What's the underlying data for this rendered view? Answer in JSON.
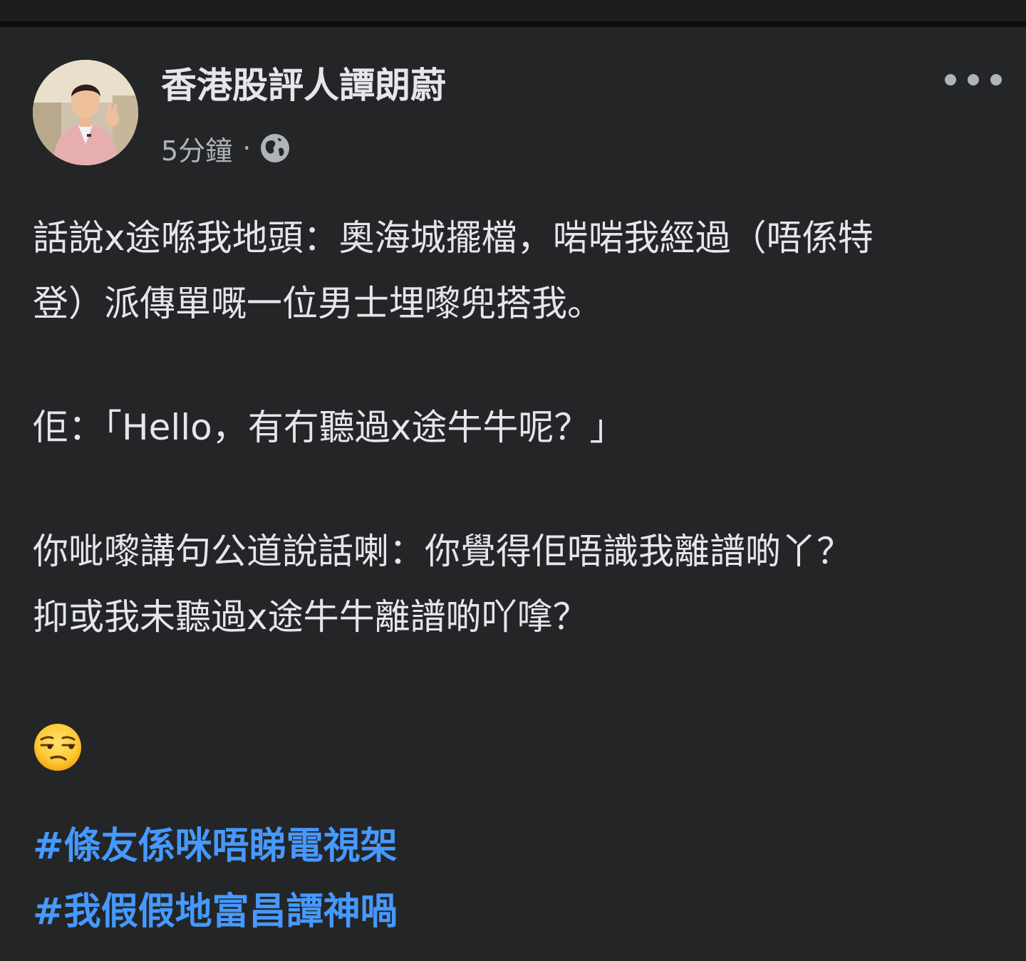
{
  "post": {
    "author": "香港股評人譚朗蔚",
    "timestamp": "5分鐘",
    "separator": "·",
    "privacy_icon": "globe-icon",
    "more_icon": "more-options-icon",
    "body": {
      "line1": "話說x途喺我地頭：奧海城擺檔，啱啱我經過（唔係特",
      "line2": "登）派傳單嘅一位男士埋嚟兜搭我。",
      "line3": "佢：「Hello，有冇聽過x途牛牛呢？」",
      "line4": "你呲嚟講句公道說話喇：你覺得佢唔識我離譜啲丫？",
      "line5": "抑或我未聽過x途牛牛離譜啲吖嗱？",
      "emoji": "unamused-face-emoji"
    },
    "hashtags": [
      "#條友係咪唔睇電視架",
      "#我假假地富昌譚神喎"
    ]
  },
  "colors": {
    "background": "#242526",
    "text": "#e4e6eb",
    "secondary_text": "#b0b3b8",
    "hashtag": "#4599ff"
  }
}
